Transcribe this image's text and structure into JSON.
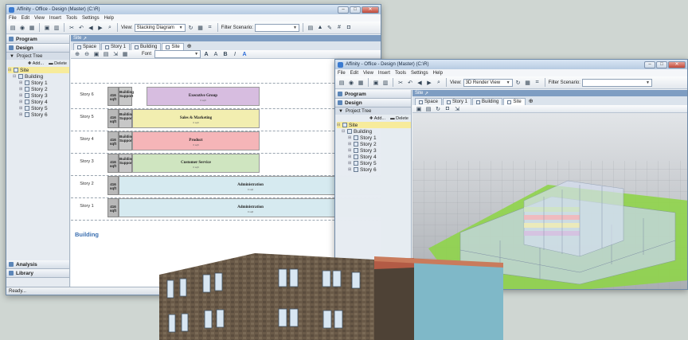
{
  "window_a": {
    "title": "Affinity - Office - Design (Master) (C:\\R)",
    "menu": [
      "File",
      "Edit",
      "View",
      "Insert",
      "Tools",
      "Settings",
      "Help"
    ],
    "view_label": "View:",
    "view_value": "Stacking Diagram",
    "filter_label": "Filter Scenario:",
    "filter_value": "",
    "program": "Program",
    "design": "Design",
    "project_tree": "Project Tree",
    "add": "Add...",
    "delete": "Delete",
    "tree": [
      "Site",
      "Building",
      "Story 1",
      "Story 2",
      "Story 3",
      "Story 4",
      "Story 5",
      "Story 6"
    ],
    "analysis": "Analysis",
    "library": "Library",
    "status": "Ready...",
    "breadcrumb": "Site",
    "tabs": [
      "Space",
      "Story 1",
      "Building",
      "Site"
    ],
    "font_label": "Font",
    "building_label": "Building",
    "rows": [
      {
        "story": "Story 6",
        "sqft": "416 sqft",
        "support": "Building Support",
        "dept": "Executive Group",
        "sub": "0 sqft",
        "color": "#d7bde0"
      },
      {
        "story": "Story 5",
        "sqft": "416 sqft",
        "support": "Building Support",
        "dept": "Sales & Marketing",
        "sub": "0 sqft",
        "color": "#f2eeb0"
      },
      {
        "story": "Story 4",
        "sqft": "416 sqft",
        "support": "Building Support",
        "dept": "Product",
        "sub": "0 sqft",
        "color": "#f5b5b8"
      },
      {
        "story": "Story 3",
        "sqft": "416 sqft",
        "support": "Building Support",
        "dept": "Customer Service",
        "sub": "0 sqft",
        "color": "#cfe5c0"
      },
      {
        "story": "Story 2",
        "sqft": "416 sqft",
        "support": "",
        "dept": "Administration",
        "sub": "0 sqft",
        "color": "#d6eaf0"
      },
      {
        "story": "Story 1",
        "sqft": "416 sqft",
        "support": "",
        "dept": "Administration",
        "sub": "0 sqft",
        "color": "#d6eaf0"
      }
    ]
  },
  "window_b": {
    "title": "Affinity - Office - Design (Master) (C:\\R)",
    "menu": [
      "File",
      "Edit",
      "View",
      "Insert",
      "Tools",
      "Settings",
      "Help"
    ],
    "view_label": "View:",
    "view_value": "3D Render View",
    "filter_label": "Filter Scenario:",
    "filter_value": "",
    "program": "Program",
    "design": "Design",
    "project_tree": "Project Tree",
    "add": "Add...",
    "delete": "Delete",
    "tree": [
      "Site",
      "Building",
      "Story 1",
      "Story 2",
      "Story 3",
      "Story 4",
      "Story 5",
      "Story 6"
    ],
    "breadcrumb": "Site",
    "tabs": [
      "Space",
      "Story 1",
      "Building",
      "Site"
    ]
  },
  "colors": {
    "ground": "#8fd44a",
    "glass": "#c7d6ea",
    "brick": "#6a5a48",
    "facade": "#7fb8c8"
  }
}
